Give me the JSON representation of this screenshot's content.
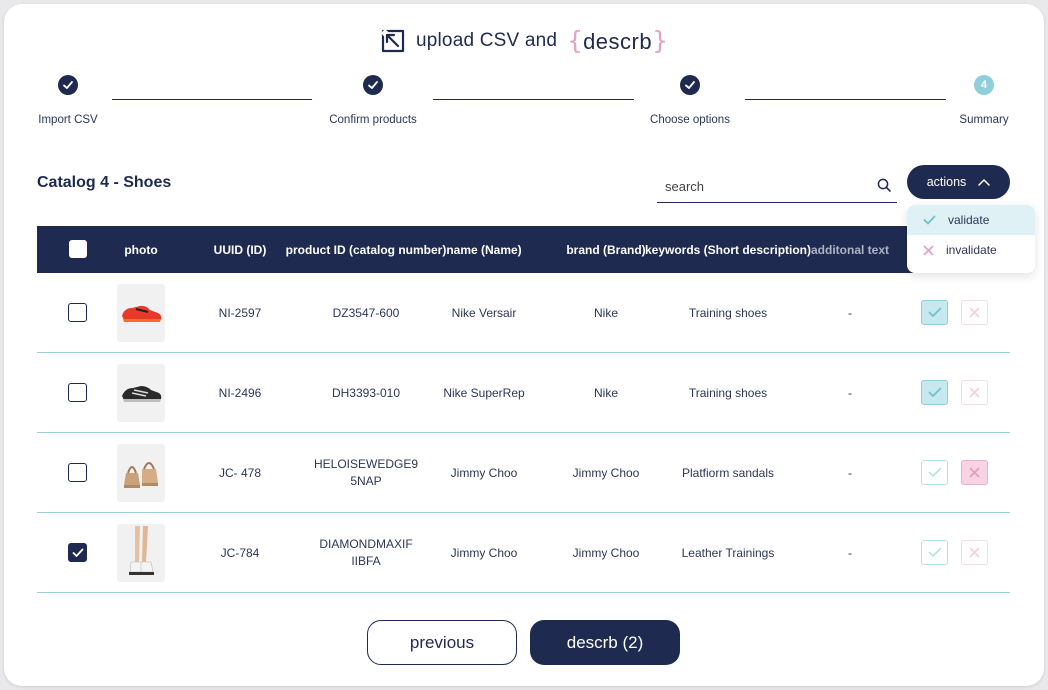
{
  "header": {
    "title": "upload CSV and",
    "brand_open": "{",
    "brand": "descrb",
    "brand_close": "}",
    "upload_icon": "arrow-upload-icon"
  },
  "stepper": {
    "steps": [
      {
        "label": "Import CSV",
        "state": "done"
      },
      {
        "label": "Confirm products",
        "state": "done"
      },
      {
        "label": "Choose options",
        "state": "done"
      },
      {
        "label": "Summary",
        "state": "current",
        "number": "4"
      }
    ]
  },
  "catalog": {
    "title": "Catalog 4 - Shoes"
  },
  "search": {
    "placeholder": "search",
    "icon": "search-icon"
  },
  "actions": {
    "label": "actions",
    "menu": [
      {
        "label": "validate",
        "icon": "check-icon"
      },
      {
        "label": "invalidate",
        "icon": "x-icon"
      }
    ]
  },
  "table": {
    "columns": [
      "photo",
      "UUID (ID)",
      "product ID (catalog number)",
      "name (Name)",
      "brand (Brand)",
      "keywords (Short description)",
      "additonal text"
    ],
    "rows": [
      {
        "uuid": "NI-2597",
        "product_id": "DZ3547-600",
        "name": "Nike Versair",
        "brand": "Nike",
        "keywords": "Training shoes",
        "additional": "-",
        "checked": false,
        "validated": true,
        "invalidated": false,
        "photo": "red-sneaker"
      },
      {
        "uuid": "NI-2496",
        "product_id": "DH3393-010",
        "name": "Nike SuperRep",
        "brand": "Nike",
        "keywords": "Training shoes",
        "additional": "-",
        "checked": false,
        "validated": true,
        "invalidated": false,
        "photo": "black-sneaker"
      },
      {
        "uuid": "JC- 478",
        "product_id": "HELOISEWEDGE9 5NAP",
        "name": "Jimmy Choo",
        "brand": "Jimmy Choo",
        "keywords": "Platfiorm sandals",
        "additional": "-",
        "checked": false,
        "validated": false,
        "invalidated": true,
        "photo": "platform-sandal"
      },
      {
        "uuid": "JC-784",
        "product_id": "DIAMONDMAXIF IIBFA",
        "name": "Jimmy Choo",
        "brand": "Jimmy Choo",
        "keywords": "Leather Trainings",
        "additional": "-",
        "checked": true,
        "validated": false,
        "invalidated": false,
        "photo": "white-trainer"
      }
    ]
  },
  "footer": {
    "previous": "previous",
    "descrb": "descrb (2)"
  },
  "colors": {
    "navy": "#1e2a4f",
    "teal": "#8ecfd9",
    "pink": "#e3a3c6"
  }
}
